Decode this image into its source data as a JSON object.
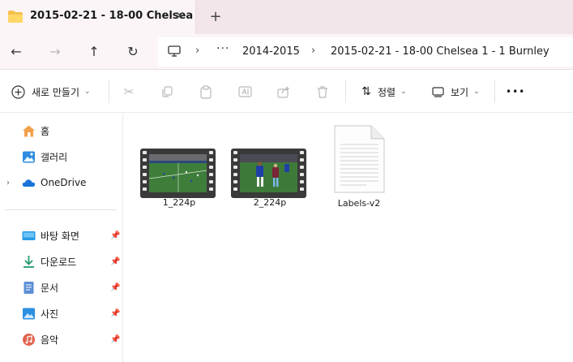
{
  "tab": {
    "title": "2015-02-21 - 18-00 Chelsea",
    "close_glyph": "✕",
    "new_tab_glyph": "+"
  },
  "nav": {
    "back": "←",
    "forward": "→",
    "up": "↑",
    "refresh": "↻",
    "more": "···",
    "breadcrumbs": [
      "2014-2015",
      "2015-02-21 - 18-00 Chelsea 1 - 1 Burnley"
    ]
  },
  "toolbar": {
    "new_label": "새로 만들기",
    "sort_label": "정렬",
    "view_label": "보기",
    "more_glyph": "•••"
  },
  "sidebar": {
    "top_items": [
      {
        "label": "홈",
        "icon": "home-icon"
      },
      {
        "label": "갤러리",
        "icon": "gallery-icon"
      },
      {
        "label": "OneDrive",
        "icon": "cloud-icon"
      }
    ],
    "pinned_items": [
      {
        "label": "바탕 화면",
        "icon": "desktop-icon"
      },
      {
        "label": "다운로드",
        "icon": "download-icon"
      },
      {
        "label": "문서",
        "icon": "document-icon"
      },
      {
        "label": "사진",
        "icon": "pictures-icon"
      },
      {
        "label": "음악",
        "icon": "music-icon"
      }
    ]
  },
  "files": [
    {
      "name": "1_224p",
      "type": "video"
    },
    {
      "name": "2_224p",
      "type": "video"
    },
    {
      "name": "Labels-v2",
      "type": "text-document"
    }
  ],
  "colors": {
    "accent": "#0067c0",
    "tab_bar": "#f3e6ea",
    "pitch": "#3f7d3b",
    "folder": "#f5c04b"
  }
}
